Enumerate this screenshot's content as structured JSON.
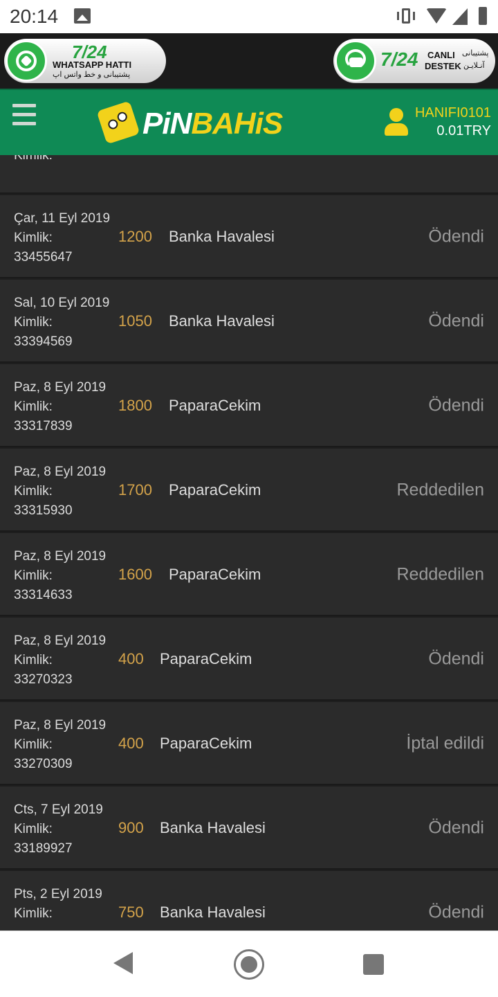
{
  "status_bar": {
    "time": "20:14"
  },
  "banner": {
    "whatsapp": {
      "big": "7/24",
      "title": "WHATSAPP HATTI",
      "subtitle": "پشتیبانی و خط واتس اپ"
    },
    "support": {
      "big": "7/24",
      "line1": "CANLI",
      "line2": "DESTEK",
      "fa1": "پشتیبانی",
      "fa2": "آنـلایـن"
    }
  },
  "header": {
    "logo_white": "PiN",
    "logo_yellow": "BAHiS",
    "username": "HANIFI0101",
    "balance": "0.01TRY"
  },
  "list": {
    "partial_top_label": "Kimlik:",
    "rows": [
      {
        "date": "Çar, 11 Eyl 2019",
        "label": "Kimlik:",
        "id": "33455647",
        "amount": "1200",
        "method": "Banka Havalesi",
        "status": "Ödendi"
      },
      {
        "date": "Sal, 10 Eyl 2019",
        "label": "Kimlik:",
        "id": "33394569",
        "amount": "1050",
        "method": "Banka Havalesi",
        "status": "Ödendi"
      },
      {
        "date": "Paz, 8 Eyl 2019",
        "label": "Kimlik:",
        "id": "33317839",
        "amount": "1800",
        "method": "PaparaCekim",
        "status": "Ödendi"
      },
      {
        "date": "Paz, 8 Eyl 2019",
        "label": "Kimlik:",
        "id": "33315930",
        "amount": "1700",
        "method": "PaparaCekim",
        "status": "Reddedilen"
      },
      {
        "date": "Paz, 8 Eyl 2019",
        "label": "Kimlik:",
        "id": "33314633",
        "amount": "1600",
        "method": "PaparaCekim",
        "status": "Reddedilen"
      },
      {
        "date": "Paz, 8 Eyl 2019",
        "label": "Kimlik:",
        "id": "33270323",
        "amount": "400",
        "method": "PaparaCekim",
        "status": "Ödendi"
      },
      {
        "date": "Paz, 8 Eyl 2019",
        "label": "Kimlik:",
        "id": "33270309",
        "amount": "400",
        "method": "PaparaCekim",
        "status": "İptal edildi"
      },
      {
        "date": "Cts, 7 Eyl 2019",
        "label": "Kimlik:",
        "id": "33189927",
        "amount": "900",
        "method": "Banka Havalesi",
        "status": "Ödendi"
      },
      {
        "date": "Pts, 2 Eyl 2019",
        "label": "Kimlik:",
        "id": "",
        "amount": "750",
        "method": "Banka Havalesi",
        "status": "Ödendi"
      }
    ]
  }
}
